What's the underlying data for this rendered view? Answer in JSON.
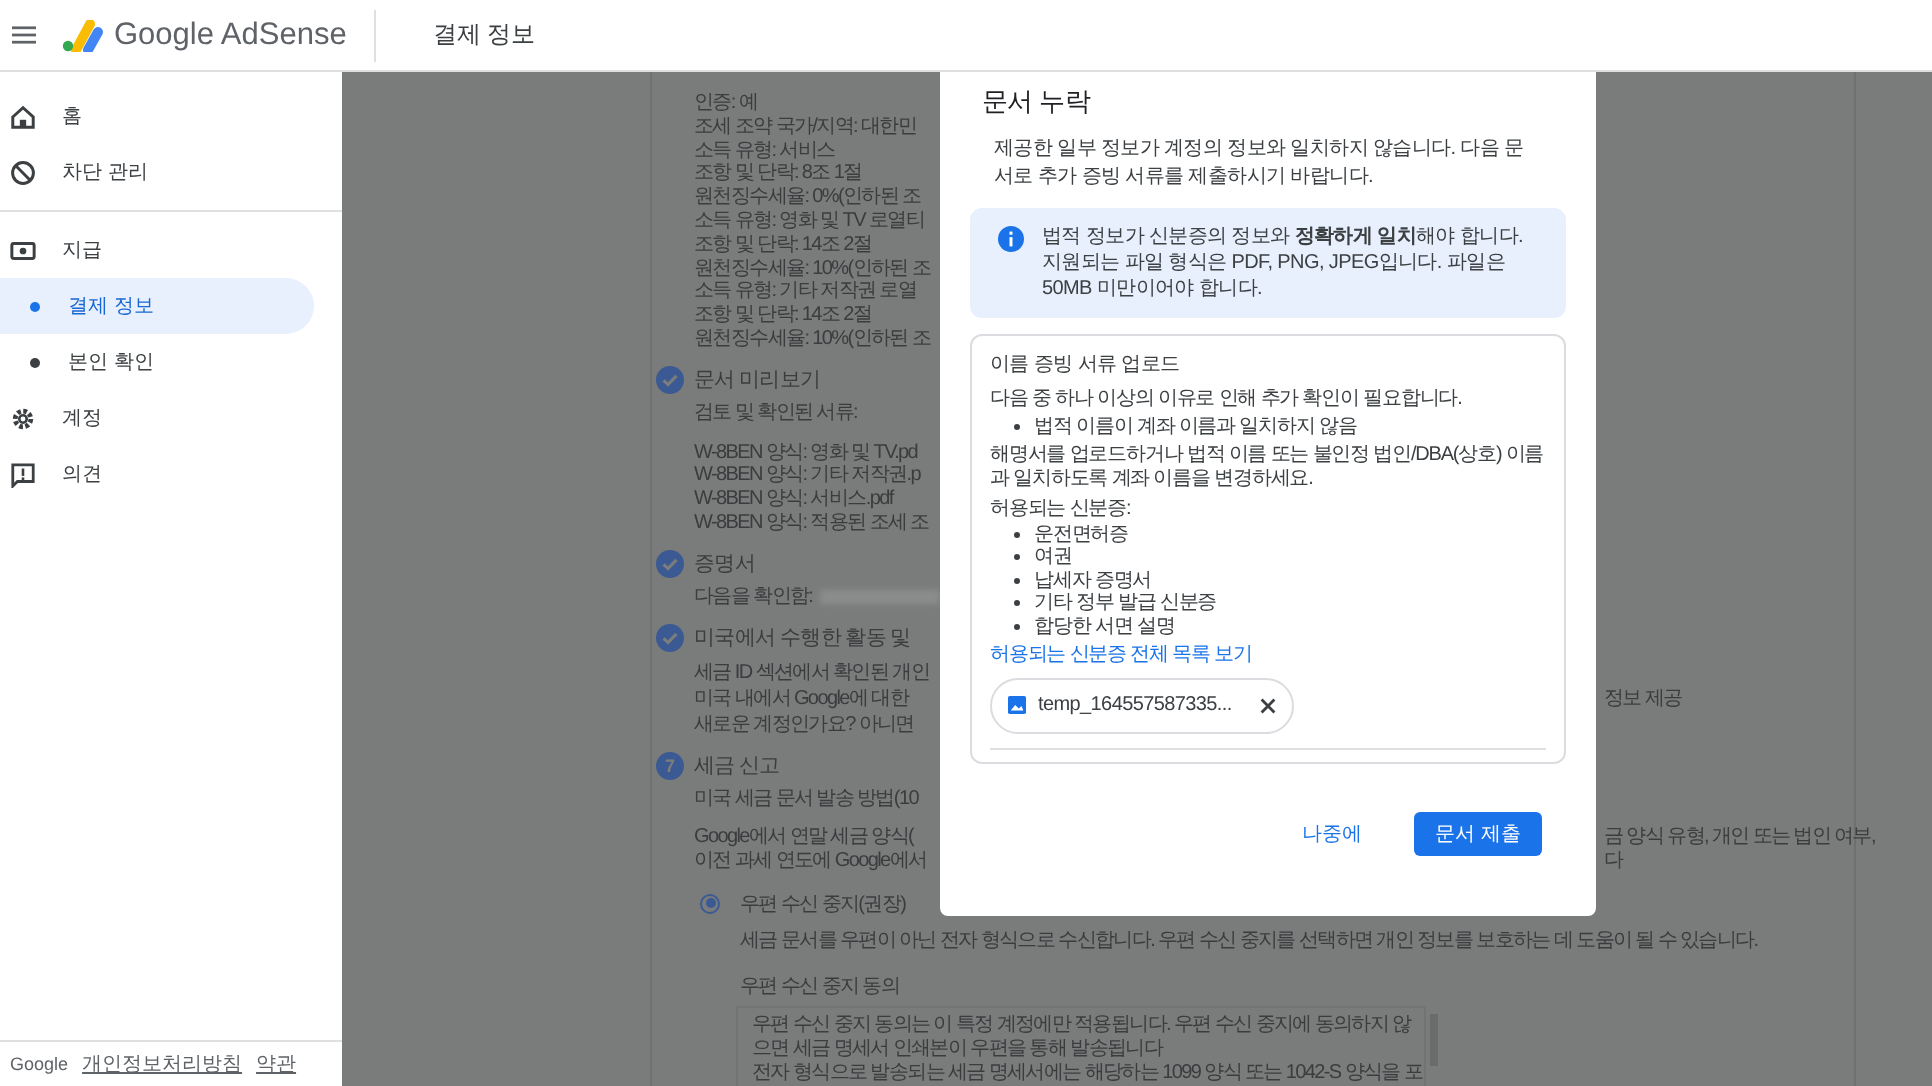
{
  "header": {
    "app_name": "Google AdSense",
    "page_title": "결제 정보"
  },
  "sidebar": {
    "groups": [
      [
        {
          "label": "홈",
          "kind": "main",
          "selected": false
        },
        {
          "label": "차단 관리",
          "kind": "main",
          "selected": false
        }
      ],
      [
        {
          "label": "지급",
          "kind": "main",
          "selected": false
        },
        {
          "label": "결제 정보",
          "kind": "sub",
          "selected": true
        },
        {
          "label": "본인 확인",
          "kind": "sub",
          "selected": false
        },
        {
          "label": "계정",
          "kind": "main",
          "selected": false
        },
        {
          "label": "의견",
          "kind": "main",
          "selected": false
        }
      ]
    ]
  },
  "footer": {
    "brand": "Google",
    "links": [
      "개인정보처리방침",
      "약관"
    ]
  },
  "main": {
    "sections": [
      {
        "paragraphs": [
          [
            {
              "kind": "text",
              "text": "인증: 예"
            },
            {
              "kind": "text",
              "text": "조세 조약 국가/지역: 대한민"
            },
            {
              "kind": "text",
              "text": "소득 유형: 서비스"
            },
            {
              "kind": "text",
              "text": "조항 및 단락: 8조 1절"
            },
            {
              "kind": "text",
              "text": "원천징수세율: 0%(인하된 조"
            },
            {
              "kind": "text",
              "text": "소득 유형: 영화 및 TV 로열티"
            },
            {
              "kind": "text",
              "text": "조항 및 단락: 14조 2절"
            },
            {
              "kind": "text",
              "text": "원천징수세율: 10%(인하된 조"
            },
            {
              "kind": "text",
              "text": "소득 유형: 기타 저작권 로열"
            },
            {
              "kind": "text",
              "text": "조항 및 단락: 14조 2절"
            },
            {
              "kind": "text",
              "text": "원천징수세율: 10%(인하된 조"
            }
          ]
        ]
      },
      {
        "title": "문서 미리보기",
        "completed": true,
        "paragraphs": [
          [
            {
              "kind": "text",
              "text": "검토 및 확인된 서류:"
            }
          ],
          [
            {
              "kind": "text",
              "text": "W-8BEN 양식: 영화 및 TV.pd"
            },
            {
              "kind": "text",
              "text": "W-8BEN 양식: 기타 저작권.p"
            },
            {
              "kind": "text",
              "text": "W-8BEN 양식: 서비스.pdf"
            },
            {
              "kind": "text",
              "text": "W-8BEN 양식: 적용된 조세 조"
            }
          ]
        ]
      },
      {
        "title": "증명서",
        "completed": true,
        "paragraphs": [
          [
            {
              "kind": "masked",
              "text": "다음을 확인함:"
            }
          ]
        ]
      },
      {
        "title": "미국에서 수행한 활동 및",
        "completed": true,
        "paragraphs": [
          [
            {
              "kind": "text",
              "text": "세금 ID 섹션에서 확인된 개인"
            },
            {
              "kind": "text",
              "text": "미국 내에서 Google에 대한",
              "right_text": "정보 제공"
            },
            {
              "kind": "text",
              "text": "새로운 계정인가요? 아니면"
            }
          ]
        ]
      },
      {
        "title": "세금 신고",
        "completed": false,
        "number": "7",
        "paragraphs": [
          [
            {
              "kind": "text",
              "text": "미국 세금 문서 발송 방법(10"
            }
          ],
          [
            {
              "kind": "text",
              "text": "Google에서 연말 세금 양식(",
              "right_text": "금 양식 유형, 개인 또는 법인 여부,"
            },
            {
              "kind": "text",
              "text": "이전 과세 연도에 Google에서",
              "right_text": "다"
            }
          ]
        ],
        "option": {
          "label": "우편 수신 중지(권장)",
          "selected": true,
          "description": "세금 문서를 우편이 아닌 전자 형식으로 수신합니다. 우편 수신 중지를 선택하면 개인 정보를 보호하는 데 도움이 될 수 있습니다.",
          "consent_title": "우편 수신 중지 동의",
          "consent_paragraphs": [
            "우편 수신 중지 동의는 이 특정 계정에만 적용됩니다. 우편 수신 중지에 동의하지 않으면 세금 명세서 인쇄본이 우편을 통해 발송됩니다",
            "전자 형식으로 발송되는 세금 명세서에는 해당하는 1099 양식 또는 1042-S 양식을 포"
          ]
        }
      }
    ]
  },
  "dialog": {
    "title": "문서 누락",
    "intro": "제공한 일부 정보가 계정의 정보와 일치하지 않습니다. 다음 문서로 추가 증빙 서류를 제출하시기 바랍니다.",
    "notice": "법적 정보가 신분증의 정보와 **정확하게 일치**해야 합니다. 지원되는 파일 형식은 PDF, PNG, JPEG입니다. 파일은 50MB 미만이어야 합니다.",
    "upload": {
      "title": "이름 증빙 서류 업로드",
      "reason_intro": "다음 중 하나 이상의 이유로 인해 추가 확인이 필요합니다.",
      "reasons": [
        "법적 이름이 계좌 이름과 일치하지 않음"
      ],
      "instruction": "해명서를 업로드하거나 법적 이름 또는 불인정 법인/DBA(상호) 이름과 일치하도록 계좌 이름을 변경하세요.",
      "accepted_title": "허용되는 신분증:",
      "accepted": [
        "운전면허증",
        "여권",
        "납세자 증명서",
        "기타 정부 발급 신분증",
        "합당한 서면 설명"
      ],
      "link": "허용되는 신분증 전체 목록 보기",
      "file": {
        "name": "temp_164557587335..."
      }
    },
    "buttons": {
      "secondary": "나중에",
      "primary": "문서 제출"
    }
  }
}
